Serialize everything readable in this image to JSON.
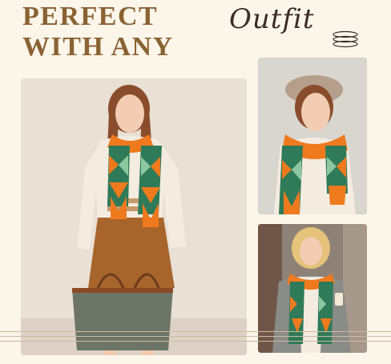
{
  "headline": {
    "line1": "PERFECT",
    "line2": "WITH ANY",
    "script_word": "Outfit"
  },
  "colors": {
    "headline": "#8a6232",
    "script": "#3a2d22",
    "background": "#fbf5ea",
    "scarf_orange": "#ef7a1e",
    "scarf_green": "#2f7a58",
    "scarf_mint": "#8cc7a0",
    "scarf_cream": "#f4ead6"
  },
  "icons": [
    "coil-decoration-icon",
    "decorative-stripes"
  ]
}
